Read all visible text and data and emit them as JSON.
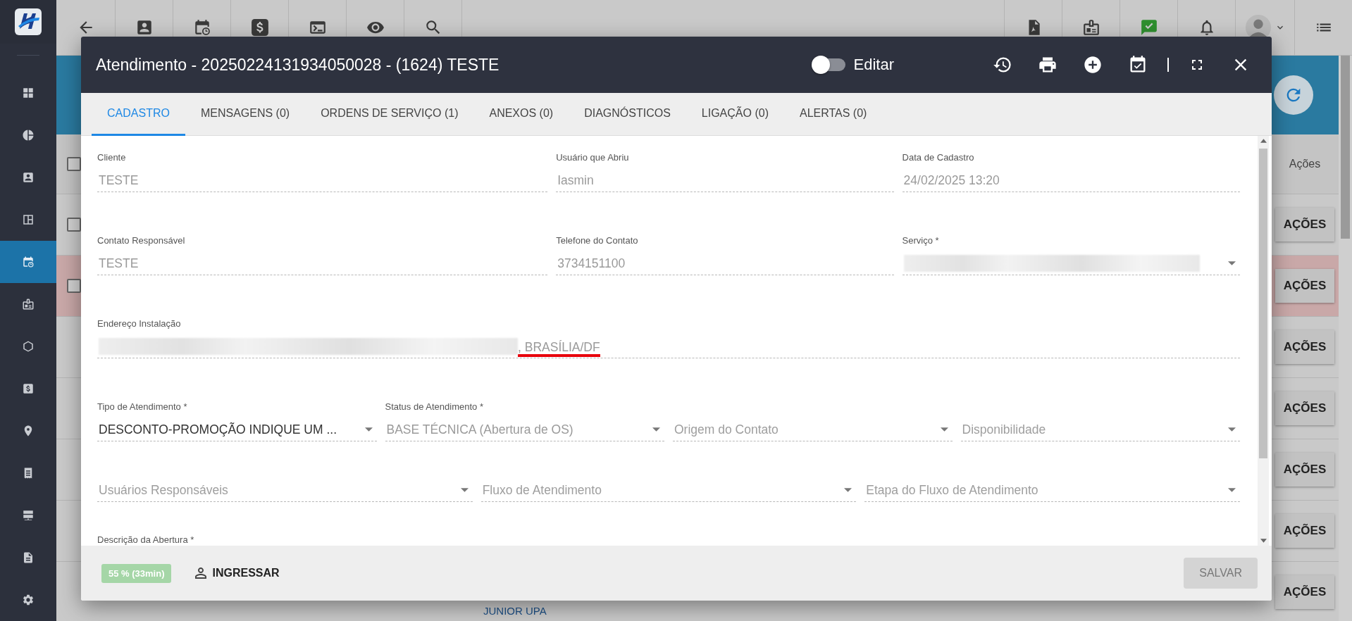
{
  "sidebar": {
    "items": [
      {
        "selected": false
      },
      {
        "selected": false
      },
      {
        "selected": false
      },
      {
        "selected": false
      },
      {
        "selected": true
      },
      {
        "selected": false
      },
      {
        "selected": false
      },
      {
        "selected": false
      },
      {
        "selected": false
      },
      {
        "selected": false
      },
      {
        "selected": false
      },
      {
        "selected": false
      },
      {
        "selected": false
      }
    ]
  },
  "background_table": {
    "header_checkbox": {
      "checked": false
    },
    "header": "Ações",
    "rows": [
      {
        "action": "AÇÕES",
        "checked": false,
        "highlighted": false
      },
      {
        "action": "AÇÕES",
        "checked": false,
        "highlighted": true
      },
      {
        "action": "AÇÕES",
        "highlighted": false
      },
      {
        "action": "AÇÕES",
        "highlighted": false
      },
      {
        "action": "AÇÕES",
        "highlighted": false
      },
      {
        "action": "AÇÕES",
        "highlighted": false
      },
      {
        "action": "AÇÕES",
        "highlighted": false,
        "link": "JUNIOR UPA"
      }
    ]
  },
  "modal": {
    "title": "Atendimento - 20250224131934050028 - (1624) TESTE",
    "edit_toggle": {
      "label": "Editar",
      "on": false
    },
    "tabs": [
      {
        "label": "CADASTRO",
        "selected": true
      },
      {
        "label": "MENSAGENS (0)",
        "selected": false
      },
      {
        "label": "ORDENS DE SERVIÇO (1)",
        "selected": false
      },
      {
        "label": "ANEXOS (0)",
        "selected": false
      },
      {
        "label": "DIAGNÓSTICOS",
        "selected": false
      },
      {
        "label": "LIGAÇÃO (0)",
        "selected": false
      },
      {
        "label": "ALERTAS (0)",
        "selected": false
      }
    ],
    "form_rows": [
      {
        "kind": "wide-first",
        "fields": [
          {
            "kind": "text",
            "label": "Cliente",
            "value": "TESTE",
            "disabled": true
          },
          {
            "kind": "text",
            "label": "Usuário que Abriu",
            "value": "Iasmin",
            "disabled": true
          },
          {
            "kind": "text",
            "label": "Data de Cadastro",
            "value": "24/02/2025 13:20",
            "disabled": true
          }
        ]
      },
      {
        "kind": "wide-first",
        "fields": [
          {
            "kind": "text",
            "label": "Contato Responsável",
            "value": "TESTE",
            "disabled": true
          },
          {
            "kind": "text",
            "label": "Telefone do Contato",
            "value": "3734151100",
            "disabled": true
          },
          {
            "kind": "select",
            "label": "Serviço *",
            "redacted": true
          }
        ]
      },
      {
        "kind": "full",
        "fields": [
          {
            "kind": "text",
            "label": "Endereço Instalação",
            "redacted": true,
            "value": ", BRASÍLIA/DF",
            "highlighted": true,
            "disabled": true
          }
        ]
      },
      {
        "kind": "four",
        "fields": [
          {
            "kind": "select",
            "label": "Tipo de Atendimento *",
            "value": "DESCONTO-PROMOÇÃO INDIQUE UM ...",
            "disabled": false
          },
          {
            "kind": "select",
            "label": "Status de Atendimento *",
            "value": "BASE TÉCNICA (Abertura de OS)",
            "disabled": true
          },
          {
            "kind": "select",
            "placeholder": "Origem do Contato"
          },
          {
            "kind": "select",
            "placeholder": "Disponibilidade"
          }
        ]
      },
      {
        "kind": "three",
        "fields": [
          {
            "kind": "select",
            "placeholder": "Usuários Responsáveis"
          },
          {
            "kind": "select",
            "placeholder": "Fluxo de Atendimento"
          },
          {
            "kind": "select",
            "placeholder": "Etapa do Fluxo de Atendimento"
          }
        ]
      }
    ],
    "description_label": "Descrição da Abertura *",
    "footer": {
      "badge": "55 % (33min)",
      "join_button": "INGRESSAR",
      "save_button": {
        "label": "SALVAR",
        "disabled": true
      }
    }
  }
}
